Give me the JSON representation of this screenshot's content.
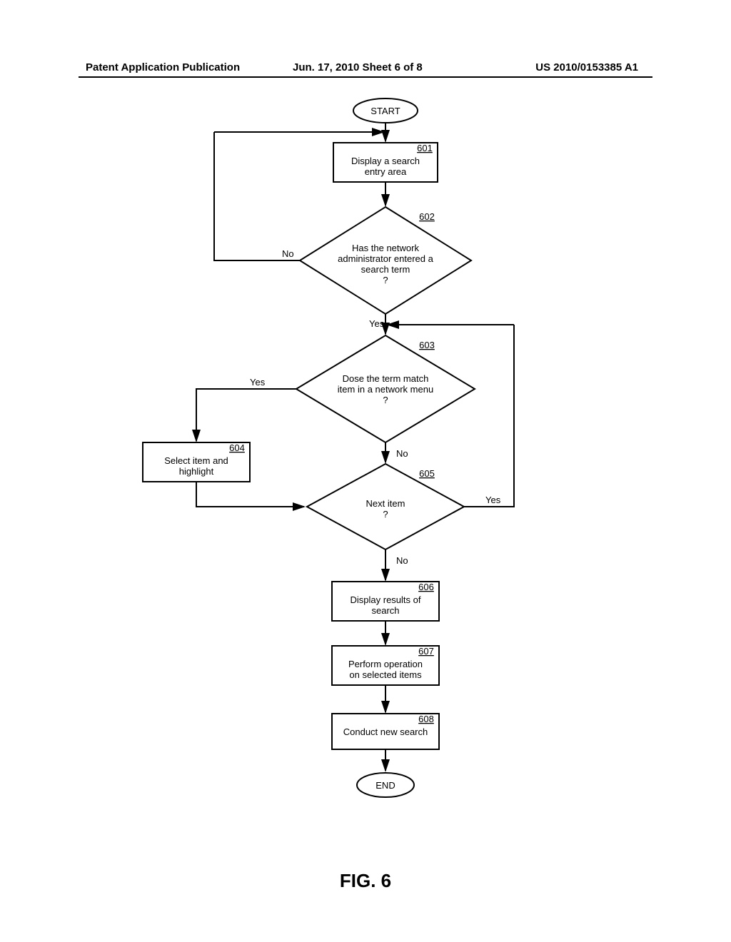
{
  "header": {
    "left": "Patent Application Publication",
    "mid": "Jun. 17, 2010  Sheet 6 of 8",
    "right": "US 2010/0153385 A1"
  },
  "terminals": {
    "start": "START",
    "end": "END"
  },
  "boxes": {
    "b601": {
      "ref": "601",
      "line1": "Display a search",
      "line2": "entry area"
    },
    "b604": {
      "ref": "604",
      "line1": "Select item and",
      "line2": "highlight"
    },
    "b606": {
      "ref": "606",
      "line1": "Display results of",
      "line2": "search"
    },
    "b607": {
      "ref": "607",
      "line1": "Perform operation",
      "line2": "on selected items"
    },
    "b608": {
      "ref": "608",
      "line1": "Conduct new search",
      "line2": ""
    }
  },
  "diamonds": {
    "d602": {
      "ref": "602",
      "line1": "Has the network",
      "line2": "administrator entered a",
      "line3": "search term",
      "line4": "?"
    },
    "d603": {
      "ref": "603",
      "line1": "Dose the term match",
      "line2": "item in a network menu",
      "line3": "?",
      "line4": ""
    },
    "d605": {
      "ref": "605",
      "line1": "Next item",
      "line2": "?",
      "line3": "",
      "line4": ""
    }
  },
  "labels": {
    "yes": "Yes",
    "no": "No"
  },
  "figure": "FIG. 6"
}
